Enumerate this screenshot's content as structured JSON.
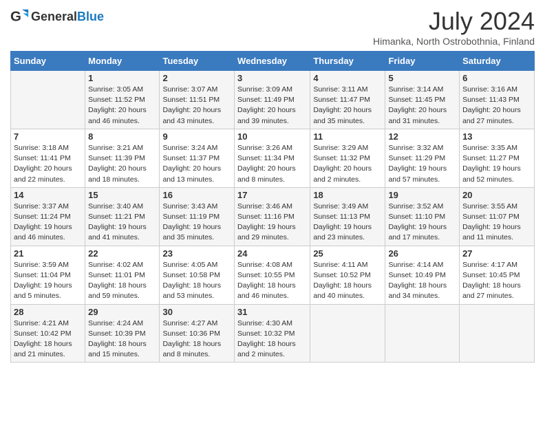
{
  "logo": {
    "text_general": "General",
    "text_blue": "Blue"
  },
  "header": {
    "month_year": "July 2024",
    "location": "Himanka, North Ostrobothnia, Finland"
  },
  "days_of_week": [
    "Sunday",
    "Monday",
    "Tuesday",
    "Wednesday",
    "Thursday",
    "Friday",
    "Saturday"
  ],
  "weeks": [
    [
      {
        "day": "",
        "info": ""
      },
      {
        "day": "1",
        "info": "Sunrise: 3:05 AM\nSunset: 11:52 PM\nDaylight: 20 hours and 46 minutes."
      },
      {
        "day": "2",
        "info": "Sunrise: 3:07 AM\nSunset: 11:51 PM\nDaylight: 20 hours and 43 minutes."
      },
      {
        "day": "3",
        "info": "Sunrise: 3:09 AM\nSunset: 11:49 PM\nDaylight: 20 hours and 39 minutes."
      },
      {
        "day": "4",
        "info": "Sunrise: 3:11 AM\nSunset: 11:47 PM\nDaylight: 20 hours and 35 minutes."
      },
      {
        "day": "5",
        "info": "Sunrise: 3:14 AM\nSunset: 11:45 PM\nDaylight: 20 hours and 31 minutes."
      },
      {
        "day": "6",
        "info": "Sunrise: 3:16 AM\nSunset: 11:43 PM\nDaylight: 20 hours and 27 minutes."
      }
    ],
    [
      {
        "day": "7",
        "info": "Sunrise: 3:18 AM\nSunset: 11:41 PM\nDaylight: 20 hours and 22 minutes."
      },
      {
        "day": "8",
        "info": "Sunrise: 3:21 AM\nSunset: 11:39 PM\nDaylight: 20 hours and 18 minutes."
      },
      {
        "day": "9",
        "info": "Sunrise: 3:24 AM\nSunset: 11:37 PM\nDaylight: 20 hours and 13 minutes."
      },
      {
        "day": "10",
        "info": "Sunrise: 3:26 AM\nSunset: 11:34 PM\nDaylight: 20 hours and 8 minutes."
      },
      {
        "day": "11",
        "info": "Sunrise: 3:29 AM\nSunset: 11:32 PM\nDaylight: 20 hours and 2 minutes."
      },
      {
        "day": "12",
        "info": "Sunrise: 3:32 AM\nSunset: 11:29 PM\nDaylight: 19 hours and 57 minutes."
      },
      {
        "day": "13",
        "info": "Sunrise: 3:35 AM\nSunset: 11:27 PM\nDaylight: 19 hours and 52 minutes."
      }
    ],
    [
      {
        "day": "14",
        "info": "Sunrise: 3:37 AM\nSunset: 11:24 PM\nDaylight: 19 hours and 46 minutes."
      },
      {
        "day": "15",
        "info": "Sunrise: 3:40 AM\nSunset: 11:21 PM\nDaylight: 19 hours and 41 minutes."
      },
      {
        "day": "16",
        "info": "Sunrise: 3:43 AM\nSunset: 11:19 PM\nDaylight: 19 hours and 35 minutes."
      },
      {
        "day": "17",
        "info": "Sunrise: 3:46 AM\nSunset: 11:16 PM\nDaylight: 19 hours and 29 minutes."
      },
      {
        "day": "18",
        "info": "Sunrise: 3:49 AM\nSunset: 11:13 PM\nDaylight: 19 hours and 23 minutes."
      },
      {
        "day": "19",
        "info": "Sunrise: 3:52 AM\nSunset: 11:10 PM\nDaylight: 19 hours and 17 minutes."
      },
      {
        "day": "20",
        "info": "Sunrise: 3:55 AM\nSunset: 11:07 PM\nDaylight: 19 hours and 11 minutes."
      }
    ],
    [
      {
        "day": "21",
        "info": "Sunrise: 3:59 AM\nSunset: 11:04 PM\nDaylight: 19 hours and 5 minutes."
      },
      {
        "day": "22",
        "info": "Sunrise: 4:02 AM\nSunset: 11:01 PM\nDaylight: 18 hours and 59 minutes."
      },
      {
        "day": "23",
        "info": "Sunrise: 4:05 AM\nSunset: 10:58 PM\nDaylight: 18 hours and 53 minutes."
      },
      {
        "day": "24",
        "info": "Sunrise: 4:08 AM\nSunset: 10:55 PM\nDaylight: 18 hours and 46 minutes."
      },
      {
        "day": "25",
        "info": "Sunrise: 4:11 AM\nSunset: 10:52 PM\nDaylight: 18 hours and 40 minutes."
      },
      {
        "day": "26",
        "info": "Sunrise: 4:14 AM\nSunset: 10:49 PM\nDaylight: 18 hours and 34 minutes."
      },
      {
        "day": "27",
        "info": "Sunrise: 4:17 AM\nSunset: 10:45 PM\nDaylight: 18 hours and 27 minutes."
      }
    ],
    [
      {
        "day": "28",
        "info": "Sunrise: 4:21 AM\nSunset: 10:42 PM\nDaylight: 18 hours and 21 minutes."
      },
      {
        "day": "29",
        "info": "Sunrise: 4:24 AM\nSunset: 10:39 PM\nDaylight: 18 hours and 15 minutes."
      },
      {
        "day": "30",
        "info": "Sunrise: 4:27 AM\nSunset: 10:36 PM\nDaylight: 18 hours and 8 minutes."
      },
      {
        "day": "31",
        "info": "Sunrise: 4:30 AM\nSunset: 10:32 PM\nDaylight: 18 hours and 2 minutes."
      },
      {
        "day": "",
        "info": ""
      },
      {
        "day": "",
        "info": ""
      },
      {
        "day": "",
        "info": ""
      }
    ]
  ]
}
